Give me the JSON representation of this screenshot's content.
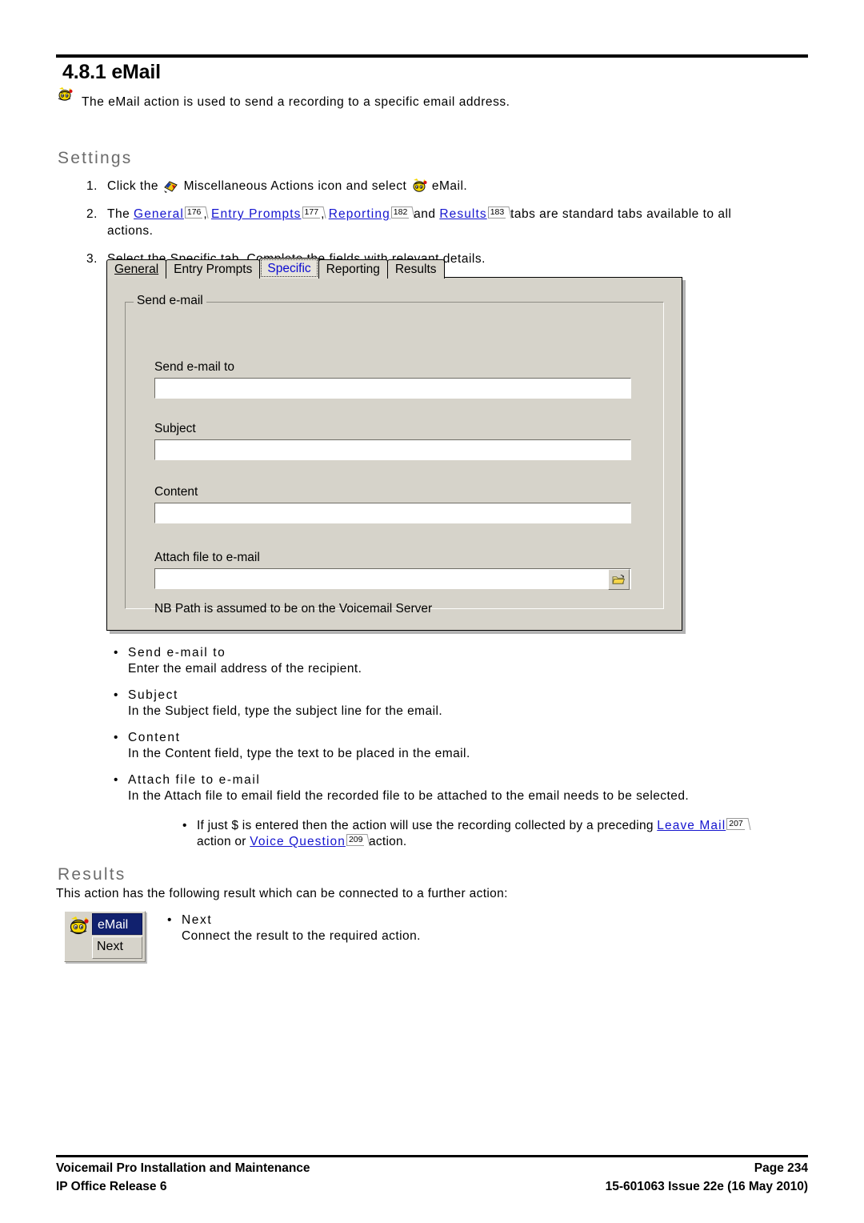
{
  "header": {
    "section_number_title": "4.8.1 eMail"
  },
  "intro": {
    "icon": "bee-email-icon",
    "text": "The eMail action is used to send a recording to a specific email address."
  },
  "settings": {
    "heading": "Settings",
    "steps": [
      {
        "num": "1.",
        "pre": "Click the",
        "icon1": "miscellaneous-actions-icon",
        "mid": "Miscellaneous Actions icon and select",
        "icon2": "bee-email-icon",
        "post": "eMail."
      },
      {
        "num": "2.",
        "pre": "The",
        "links": [
          {
            "label": "General",
            "page": "176"
          },
          {
            "label": "Entry Prompts",
            "page": "177"
          },
          {
            "label": "Reporting",
            "page": "182"
          },
          {
            "label": "Results",
            "page": "183"
          }
        ],
        "sep1": ",",
        "sep2": ",",
        "sep3": "and",
        "post": "tabs are standard tabs available to all",
        "line2": "actions."
      },
      {
        "num": "3.",
        "text": "Select the Specific tab. Complete the fields with relevant details."
      }
    ]
  },
  "dialog": {
    "tabs": [
      {
        "label": "General",
        "accel": "G",
        "active": false
      },
      {
        "label": "Entry Prompts",
        "active": false
      },
      {
        "label": "Specific",
        "active": true
      },
      {
        "label": "Reporting",
        "active": false
      },
      {
        "label": "Results",
        "active": false
      }
    ],
    "groupbox_label": "Send e-mail",
    "fields": [
      {
        "label": "Send e-mail to",
        "value": "",
        "placeholder": ""
      },
      {
        "label": "Subject",
        "value": "",
        "placeholder": ""
      },
      {
        "label": "Content",
        "value": "",
        "placeholder": ""
      },
      {
        "label": "Attach file to e-mail",
        "value": "",
        "placeholder": "",
        "browse_icon": "open-folder-icon"
      }
    ],
    "note": "NB Path is assumed to be on the Voicemail Server"
  },
  "field_help": [
    {
      "term": "Send e-mail to",
      "desc": "Enter the email address of the recipient."
    },
    {
      "term": "Subject",
      "desc": "In the Subject field, type the subject line for the email."
    },
    {
      "term": "Content",
      "desc": "In the Content field, type the text to be placed in the email."
    },
    {
      "term": "Attach file to e-mail",
      "desc": "In the Attach file to email field the recorded file to be attached to the email needs to be selected.",
      "sub": {
        "pre": "If just $ is entered then the action will use the recording collected by a preceding",
        "link1": {
          "label": "Leave Mail",
          "page": "207"
        },
        "mid": "action or",
        "link2": {
          "label": "Voice Question",
          "page": "209"
        },
        "post": "action."
      }
    }
  ],
  "results": {
    "heading": "Results",
    "intro": "This action has the following result which can be connected to a further action:",
    "action_icon": {
      "title": "eMail",
      "result": "Next",
      "icon": "bee-email-icon",
      "title_bar_color": "#11216e"
    },
    "bullets": [
      {
        "term": "Next",
        "desc": "Connect the result to the required action."
      }
    ]
  },
  "footer": {
    "left_line1": "Voicemail Pro Installation and Maintenance",
    "left_line2": "IP Office Release 6",
    "right_line1": "Page 234",
    "right_line2": "15-601063 Issue 22e (16 May 2010)"
  }
}
